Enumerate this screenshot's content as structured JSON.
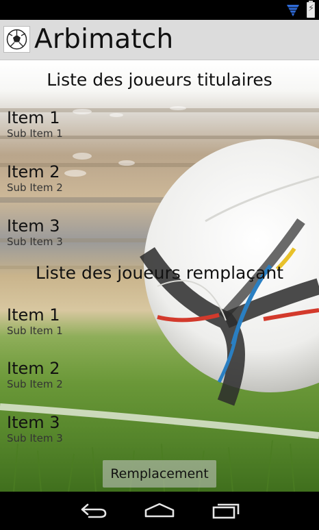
{
  "app": {
    "title": "Arbimatch",
    "icon": "soccer-ball-icon"
  },
  "status_bar": {
    "icons": [
      "wifi-icon",
      "battery-charging-icon"
    ]
  },
  "starters": {
    "header": "Liste des joueurs titulaires",
    "items": [
      {
        "title": "Item 1",
        "subtitle": "Sub Item 1"
      },
      {
        "title": "Item 2",
        "subtitle": "Sub Item 2"
      },
      {
        "title": "Item 3",
        "subtitle": "Sub Item 3"
      }
    ]
  },
  "substitutes": {
    "header": "Liste des joueurs remplaçant",
    "items": [
      {
        "title": "Item 1",
        "subtitle": "Sub Item 1"
      },
      {
        "title": "Item 2",
        "subtitle": "Sub Item 2"
      },
      {
        "title": "Item 3",
        "subtitle": "Sub Item 3"
      }
    ]
  },
  "actions": {
    "replace_label": "Remplacement"
  },
  "nav_bar": {
    "buttons": [
      "back-icon",
      "home-icon",
      "recent-apps-icon"
    ]
  },
  "colors": {
    "action_bar": "#dcdcdc",
    "status_accent": "#2f6bd8",
    "grass": "#4e8a2a"
  }
}
